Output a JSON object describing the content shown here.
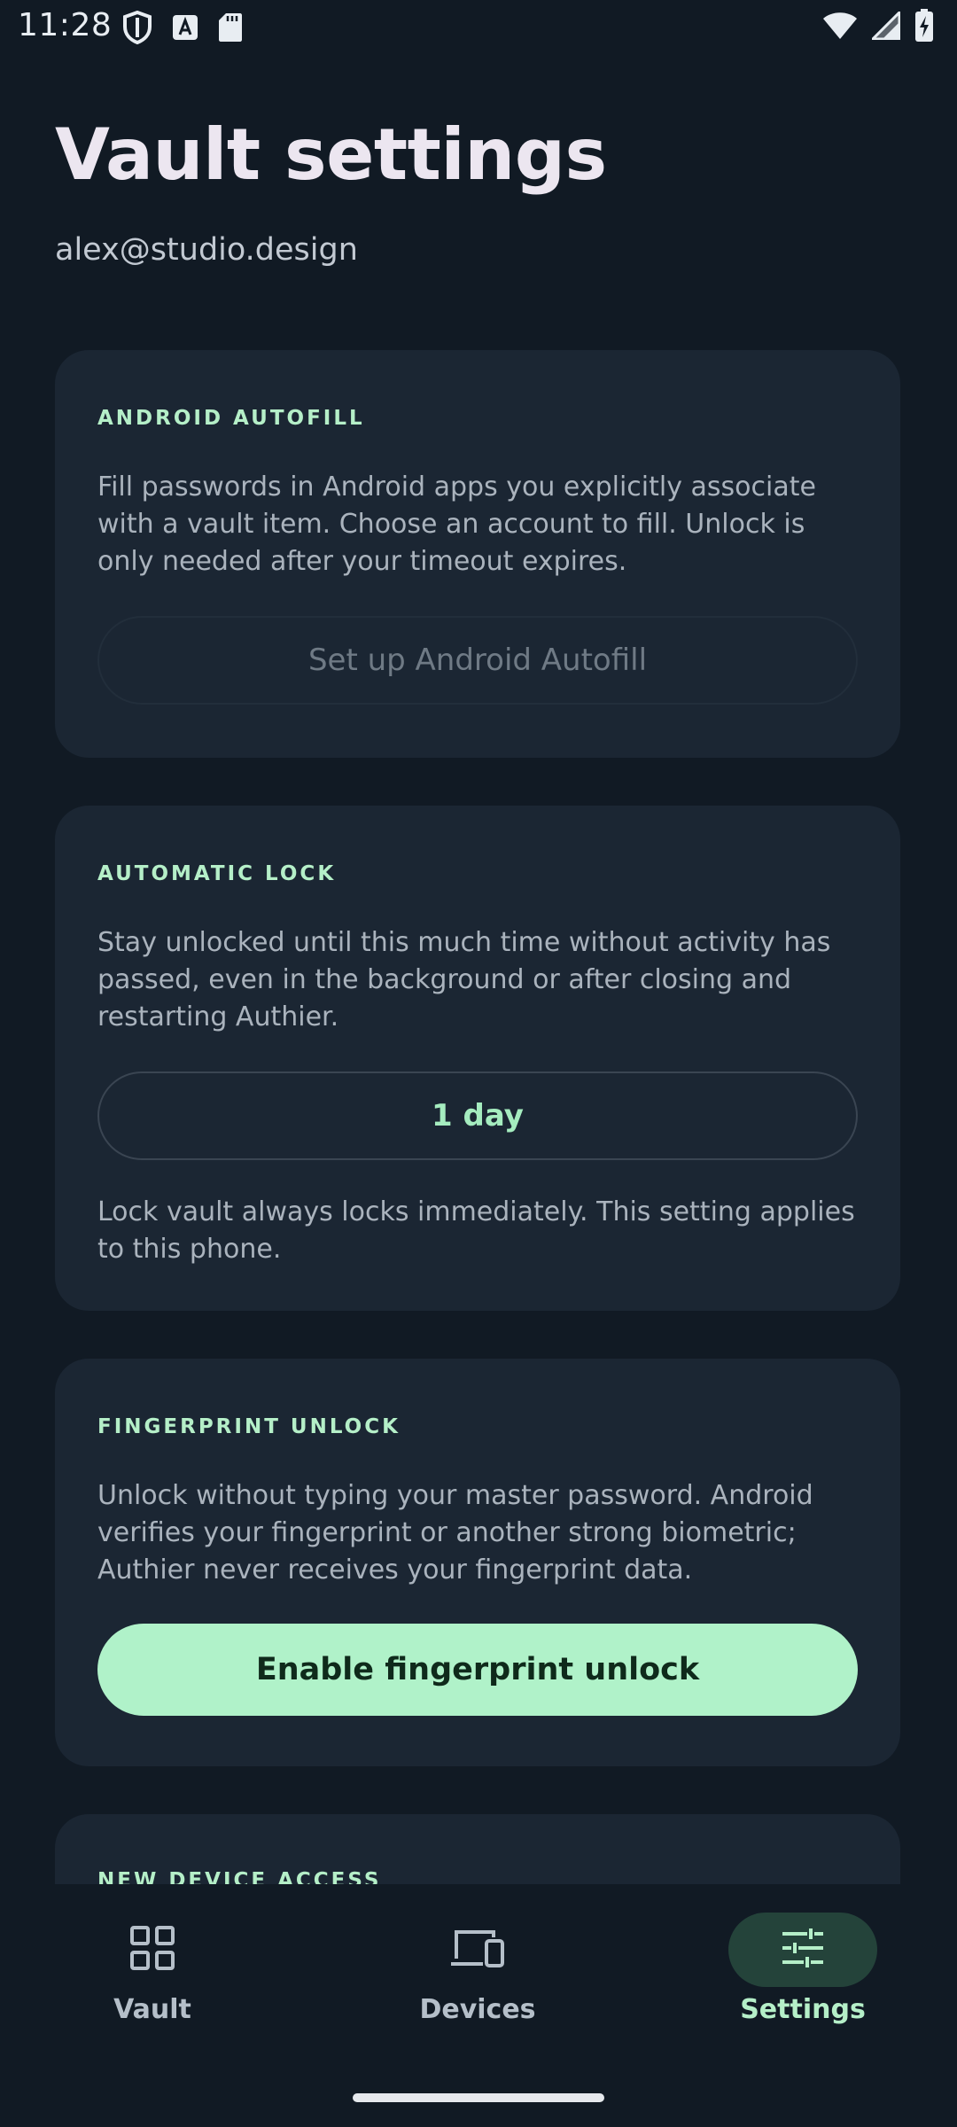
{
  "status_bar": {
    "time": "11:28"
  },
  "header": {
    "title": "Vault settings",
    "email": "alex@studio.design"
  },
  "cards": {
    "autofill": {
      "heading": "ANDROID AUTOFILL",
      "description": "Fill passwords in Android apps you explicitly associate with a vault item. Choose an account to fill. Unlock is only needed after your timeout expires.",
      "button_label": "Set up Android Autofill"
    },
    "auto_lock": {
      "heading": "AUTOMATIC LOCK",
      "description": "Stay unlocked until this much time without activity has passed, even in the background or after closing and restarting Authier.",
      "selected_value": "1 day",
      "footnote": "Lock vault always locks immediately. This setting applies to this phone."
    },
    "fingerprint": {
      "heading": "FINGERPRINT UNLOCK",
      "description": "Unlock without typing your master password. Android verifies your fingerprint or another strong biometric; Authier never receives your fingerprint data.",
      "button_label": "Enable fingerprint unlock"
    },
    "new_device": {
      "heading": "NEW DEVICE ACCESS"
    }
  },
  "bottom_nav": {
    "items": [
      {
        "label": "Vault",
        "icon": "grid-icon"
      },
      {
        "label": "Devices",
        "icon": "devices-icon"
      },
      {
        "label": "Settings",
        "icon": "sliders-icon"
      }
    ],
    "active": "Settings"
  },
  "colors": {
    "background": "#111a24",
    "card": "#1b2633",
    "accent": "#b0f2c9",
    "accent_text": "#b5efc8"
  }
}
